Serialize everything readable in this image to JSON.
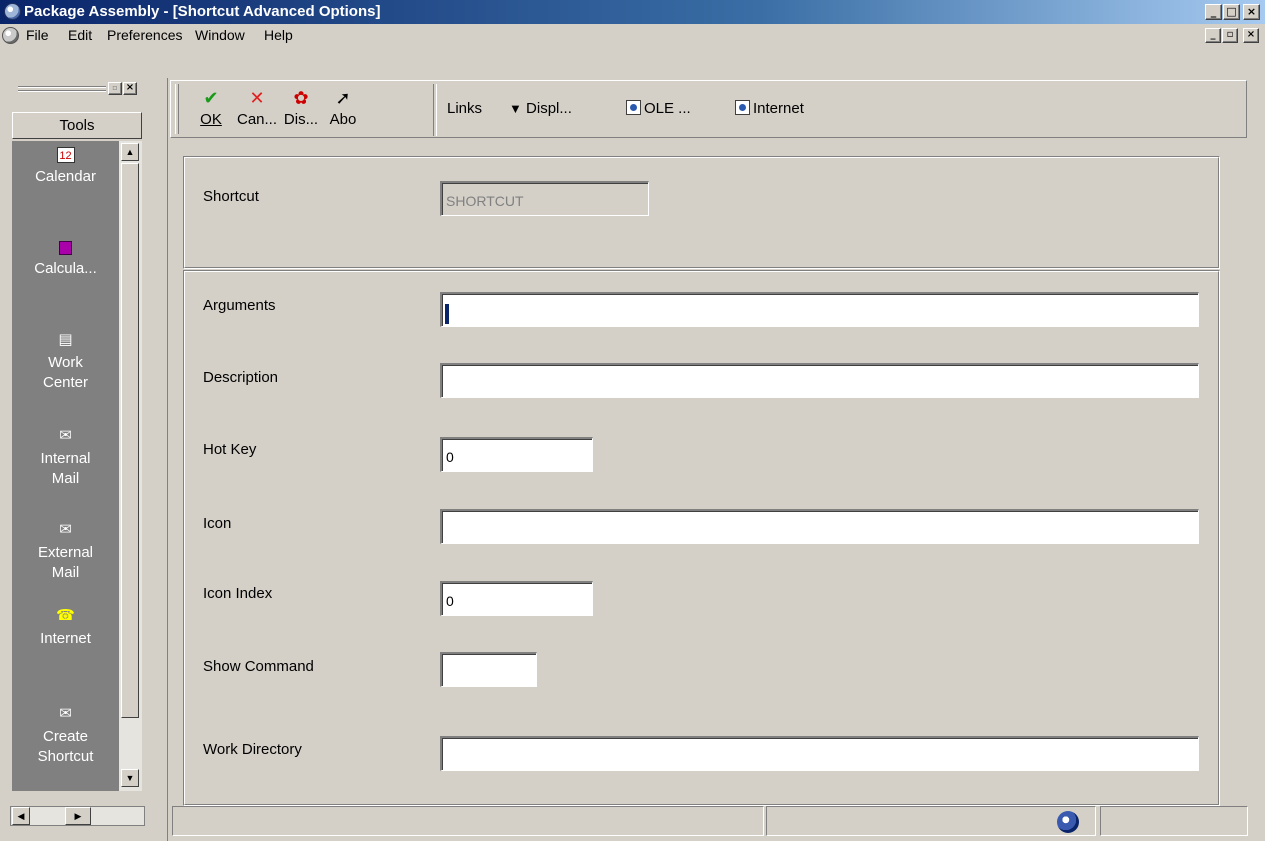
{
  "window": {
    "title": "Package Assembly - [Shortcut Advanced Options]"
  },
  "menubar": {
    "items": [
      "File",
      "Edit",
      "Preferences",
      "Window",
      "Help"
    ]
  },
  "tools_panel": {
    "header": "Tools",
    "items": [
      {
        "label": "Calendar",
        "icon": "calendar-icon"
      },
      {
        "label": "Calcula...",
        "icon": "calculator-icon"
      },
      {
        "label": "Work Center",
        "icon": "work-center-icon"
      },
      {
        "label": "Internal Mail",
        "icon": "internal-mail-icon"
      },
      {
        "label": "External Mail",
        "icon": "external-mail-icon"
      },
      {
        "label": "Internet",
        "icon": "telephone-icon"
      },
      {
        "label": "Create Shortcut",
        "icon": "create-shortcut-icon"
      }
    ]
  },
  "toolbar": {
    "buttons": [
      {
        "label": "OK",
        "accel": "O",
        "icon": "checkmark-icon"
      },
      {
        "label": "Can...",
        "accel": "C",
        "icon": "cancel-x-icon"
      },
      {
        "label": "Dis...",
        "accel": "",
        "icon": "display-icon"
      },
      {
        "label": "Abo",
        "accel": "b",
        "icon": "help-pointer-icon"
      }
    ],
    "links_label": "Links",
    "display_label": "Displ...",
    "ole_label": "OLE ...",
    "internet_label": "Internet"
  },
  "form": {
    "shortcut": {
      "label": "Shortcut",
      "value": "SHORTCUT"
    },
    "arguments": {
      "label": "Arguments",
      "value": ""
    },
    "description": {
      "label": "Description",
      "value": ""
    },
    "hot_key": {
      "label": "Hot Key",
      "value": "0"
    },
    "icon": {
      "label": "Icon",
      "value": ""
    },
    "icon_index": {
      "label": "Icon Index",
      "value": "0"
    },
    "show_command": {
      "label": "Show Command",
      "value": ""
    },
    "work_directory": {
      "label": "Work Directory",
      "value": ""
    }
  },
  "colors": {
    "titlebar_start": "#0a246a",
    "titlebar_end": "#a6caf0",
    "face": "#d4d0c8",
    "tools_bg": "#808080"
  }
}
